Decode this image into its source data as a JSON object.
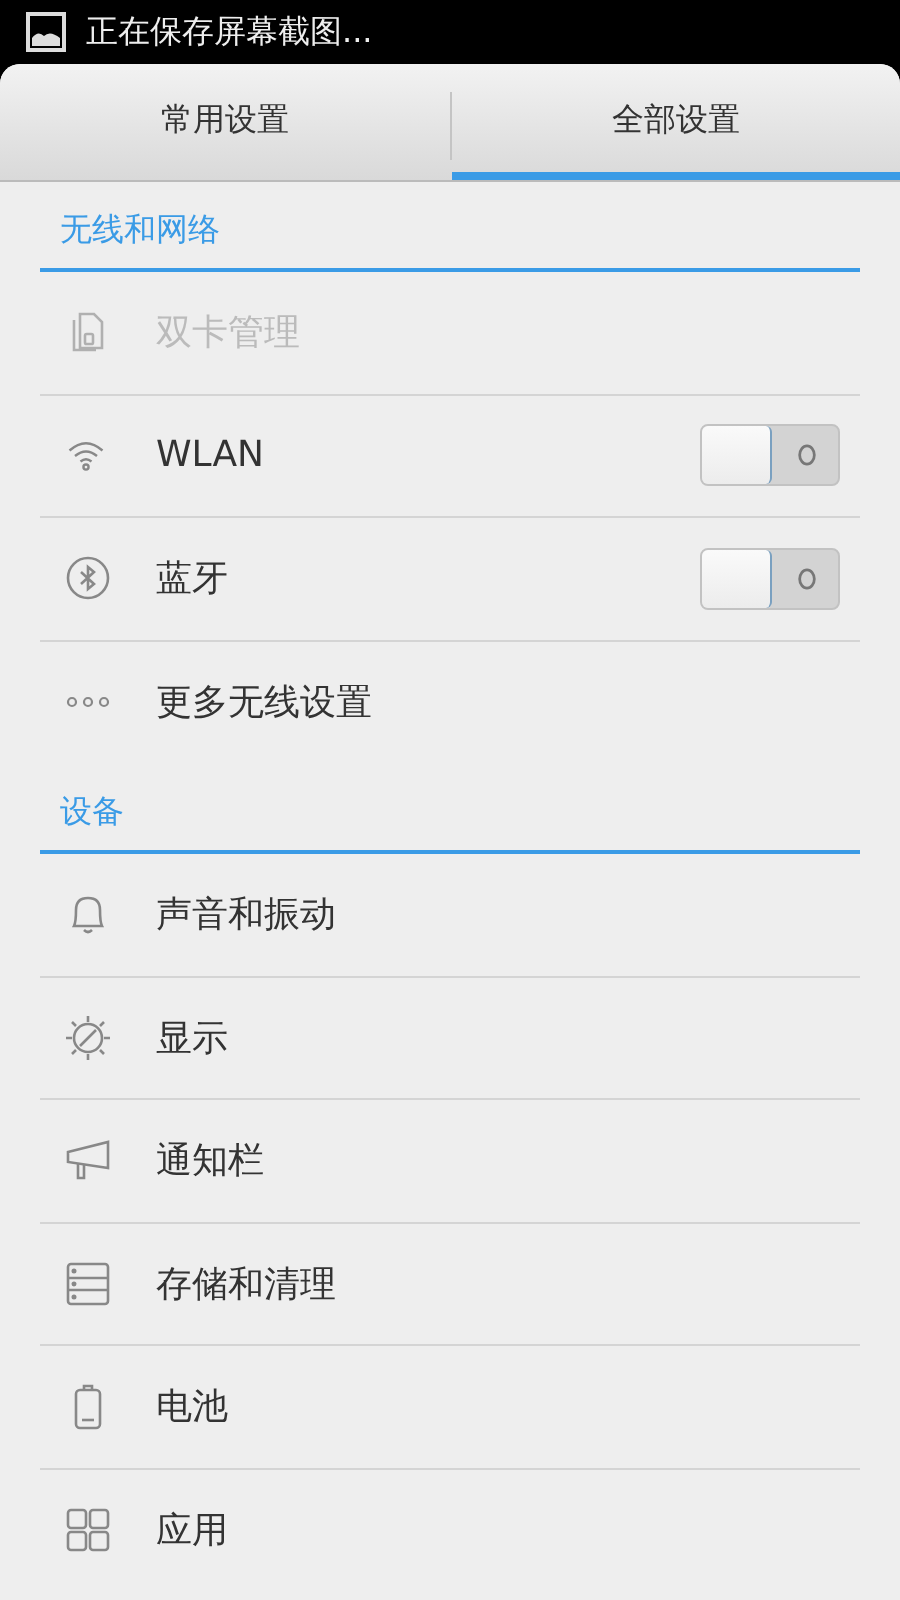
{
  "status_bar": {
    "notification": "正在保存屏幕截图..."
  },
  "tabs": [
    {
      "label": "常用设置",
      "selected": false
    },
    {
      "label": "全部设置",
      "selected": true
    }
  ],
  "sections": [
    {
      "title": "无线和网络",
      "items": [
        {
          "kind": "plain",
          "label": "双卡管理",
          "disabled": true
        },
        {
          "kind": "toggle",
          "label": "WLAN",
          "disabled": false,
          "on": false
        },
        {
          "kind": "toggle",
          "label": "蓝牙",
          "disabled": false,
          "on": false
        },
        {
          "kind": "plain",
          "label": "更多无线设置",
          "disabled": false
        }
      ]
    },
    {
      "title": "设备",
      "items": [
        {
          "kind": "plain",
          "label": "声音和振动",
          "disabled": false
        },
        {
          "kind": "plain",
          "label": "显示",
          "disabled": false
        },
        {
          "kind": "plain",
          "label": "通知栏",
          "disabled": false
        },
        {
          "kind": "plain",
          "label": "存储和清理",
          "disabled": false
        },
        {
          "kind": "plain",
          "label": "电池",
          "disabled": false
        },
        {
          "kind": "plain",
          "label": "应用",
          "disabled": false
        }
      ]
    }
  ]
}
